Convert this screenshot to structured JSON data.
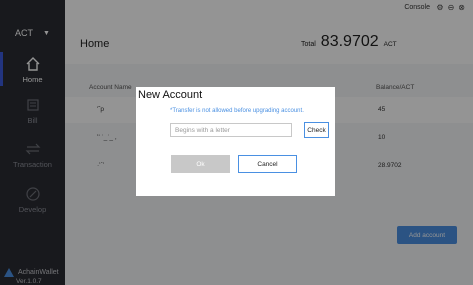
{
  "colors": {
    "accent": "#4a90e2",
    "sidebar_bg": "#2a2c33",
    "nav_selected": "#3b5bdb"
  },
  "sidebar": {
    "network": {
      "label": "ACT",
      "caret": "▼"
    },
    "items": [
      {
        "label": "Home",
        "icon": "home-icon",
        "active": true
      },
      {
        "label": "Bill",
        "icon": "bill-icon",
        "active": false
      },
      {
        "label": "Transaction",
        "icon": "transfer-icon",
        "active": false
      },
      {
        "label": "Develop",
        "icon": "develop-icon",
        "active": false
      }
    ],
    "brand": "AchainWallet",
    "version": "Ver.1.0.7"
  },
  "topbar": {
    "console_label": "Console",
    "icons": [
      "gear-icon",
      "minimize-icon",
      "close-icon"
    ],
    "page_title": "Home",
    "total_label": "Total",
    "total_value": "83.9702",
    "total_unit": "ACT"
  },
  "table": {
    "headers": {
      "account_name": "Account Name",
      "balance": "Balance/ACT"
    },
    "rows": [
      {
        "name": "'ˇp",
        "balance": "45"
      },
      {
        "name": "ʻ' ˈ_ˈ_ ,",
        "balance": "10"
      },
      {
        "name": "·ʻˊʼ",
        "balance": "28.9702"
      }
    ],
    "add_button": "Add account"
  },
  "dialog": {
    "title": "New Account",
    "notice": "*Transfer is not allowed before upgrading account.",
    "input_placeholder": "Begins with a letter",
    "input_value": "",
    "check_label": "Check",
    "ok_label": "Ok",
    "cancel_label": "Cancel"
  }
}
